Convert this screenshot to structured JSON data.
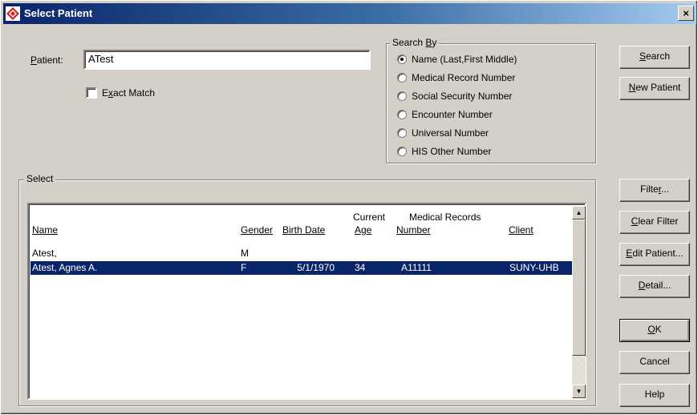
{
  "window": {
    "title": "Select Patient",
    "close_glyph": "×"
  },
  "patient": {
    "label": "Patient:",
    "value": "ATest"
  },
  "exact_match": {
    "label": "Exact Match",
    "checked": false
  },
  "search_by": {
    "legend": "Search By",
    "options": [
      {
        "label": "Name (Last,First Middle)",
        "selected": true
      },
      {
        "label": "Medical Record Number",
        "selected": false
      },
      {
        "label": "Social Security Number",
        "selected": false
      },
      {
        "label": "Encounter Number",
        "selected": false
      },
      {
        "label": "Universal Number",
        "selected": false
      },
      {
        "label": "HIS Other Number",
        "selected": false
      }
    ]
  },
  "buttons": {
    "search": "Search",
    "new_patient": "New Patient",
    "filter": "Filter...",
    "clear_filter": "Clear Filter",
    "edit_patient": "Edit Patient...",
    "detail": "Detail...",
    "ok": "OK",
    "cancel": "Cancel",
    "help": "Help"
  },
  "select_group": {
    "legend": "Select",
    "headers": {
      "name": "Name",
      "gender": "Gender",
      "birth_date": "Birth Date",
      "age_top": "Current",
      "age": "Age",
      "mr_top": "Medical Records",
      "mr_number": "Number",
      "client": "Client"
    },
    "rows": [
      {
        "name": "Atest,",
        "gender": "M",
        "birth_date": "",
        "age": "",
        "mr_number": "",
        "client": "",
        "selected": false
      },
      {
        "name": "Atest, Agnes A.",
        "gender": "F",
        "birth_date": "5/1/1970",
        "age": "34",
        "mr_number": "A11111",
        "client": "SUNY-UHB",
        "selected": true
      }
    ]
  },
  "colors": {
    "title_start": "#0a246a",
    "title_end": "#a6caf0",
    "face": "#d4d0c8",
    "selection": "#0a246a"
  }
}
